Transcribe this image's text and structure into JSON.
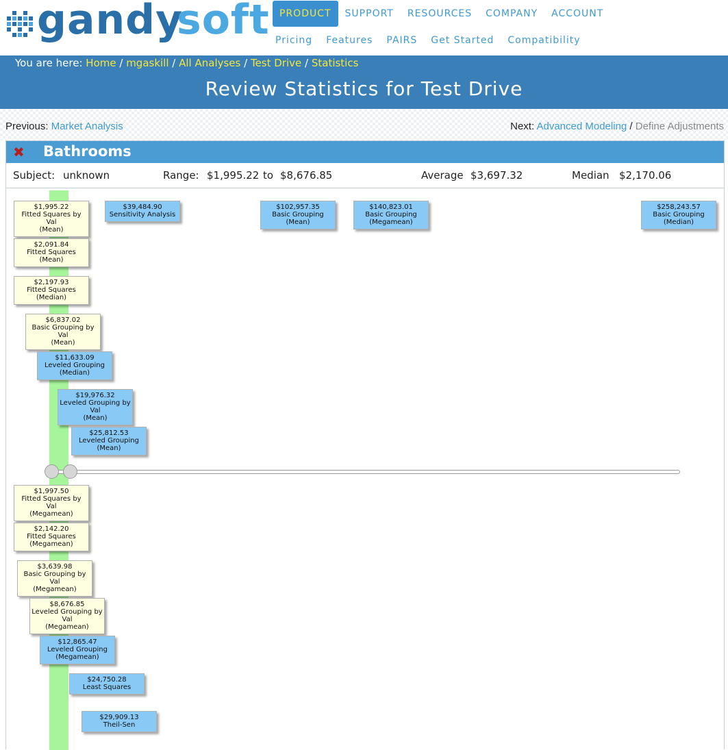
{
  "brand": {
    "part1": "gandy",
    "part2": "soft"
  },
  "nav": {
    "primary": [
      "PRODUCT",
      "SUPPORT",
      "RESOURCES",
      "COMPANY",
      "ACCOUNT"
    ],
    "secondary": [
      "Pricing",
      "Features",
      "PAIRS",
      "Get Started",
      "Compatibility"
    ]
  },
  "breadcrumb": {
    "prefix": "You are here:",
    "items": [
      "Home",
      "mgaskill",
      "All Analyses",
      "Test Drive",
      "Statistics"
    ]
  },
  "page_title": "Review Statistics for Test Drive",
  "prev": {
    "label": "Previous:",
    "link": "Market Analysis"
  },
  "next": {
    "label": "Next:",
    "link": "Advanced Modeling",
    "sep": "/",
    "muted": "Define Adjustments"
  },
  "panel": {
    "close_glyph": "✖",
    "title": "Bathrooms",
    "subject_label": "Subject:",
    "subject_value": "unknown",
    "range_label": "Range:",
    "range_min": "$1,995.22",
    "range_to": "to",
    "range_max": "$8,676.85",
    "average_label": "Average",
    "average_value": "$3,697.32",
    "median_label": "Median",
    "median_value": "$2,170.06"
  },
  "colors": {
    "accent": "#3a7fb8",
    "yellow_link": "#f5e63a",
    "card_yellow": "#fefee0",
    "card_blue": "#88c9f5",
    "range_band": "#a6f59a"
  },
  "cards_top": [
    {
      "value": "$1,995.22",
      "label": "Fitted Squares by Val",
      "stat": "(Mean)",
      "color": "yellow"
    },
    {
      "value": "$2,091.84",
      "label": "Fitted Squares",
      "stat": "(Mean)",
      "color": "yellow"
    },
    {
      "value": "$2,197.93",
      "label": "Fitted Squares",
      "stat": "(Median)",
      "color": "yellow"
    },
    {
      "value": "$6,837.02",
      "label": "Basic Grouping by Val",
      "stat": "(Mean)",
      "color": "yellow"
    },
    {
      "value": "$11,633.09",
      "label": "Leveled Grouping",
      "stat": "(Median)",
      "color": "blue"
    },
    {
      "value": "$19,976.32",
      "label": "Leveled Grouping by Val",
      "stat": "(Mean)",
      "color": "blue"
    },
    {
      "value": "$25,812.53",
      "label": "Leveled Grouping",
      "stat": "(Mean)",
      "color": "blue"
    },
    {
      "value": "$39,484.90",
      "label": "Sensitivity Analysis",
      "stat": "",
      "color": "blue"
    },
    {
      "value": "$102,957.35",
      "label": "Basic Grouping",
      "stat": "(Mean)",
      "color": "blue"
    },
    {
      "value": "$140,823.01",
      "label": "Basic Grouping",
      "stat": "(Megamean)",
      "color": "blue"
    },
    {
      "value": "$258,243.57",
      "label": "Basic Grouping",
      "stat": "(Median)",
      "color": "blue"
    }
  ],
  "cards_bottom": [
    {
      "value": "$1,997.50",
      "label": "Fitted Squares by Val",
      "stat": "(Megamean)",
      "color": "yellow"
    },
    {
      "value": "$2,142.20",
      "label": "Fitted Squares",
      "stat": "(Megamean)",
      "color": "yellow"
    },
    {
      "value": "$3,639.98",
      "label": "Basic Grouping by Val",
      "stat": "(Megamean)",
      "color": "yellow"
    },
    {
      "value": "$8,676.85",
      "label": "Leveled Grouping by Val",
      "stat": "(Megamean)",
      "color": "yellow"
    },
    {
      "value": "$12,865.47",
      "label": "Leveled Grouping",
      "stat": "(Megamean)",
      "color": "blue"
    },
    {
      "value": "$24,750.28",
      "label": "Least Squares",
      "stat": "",
      "color": "blue"
    },
    {
      "value": "$29,909.13",
      "label": "Theil-Sen",
      "stat": "",
      "color": "blue"
    }
  ]
}
